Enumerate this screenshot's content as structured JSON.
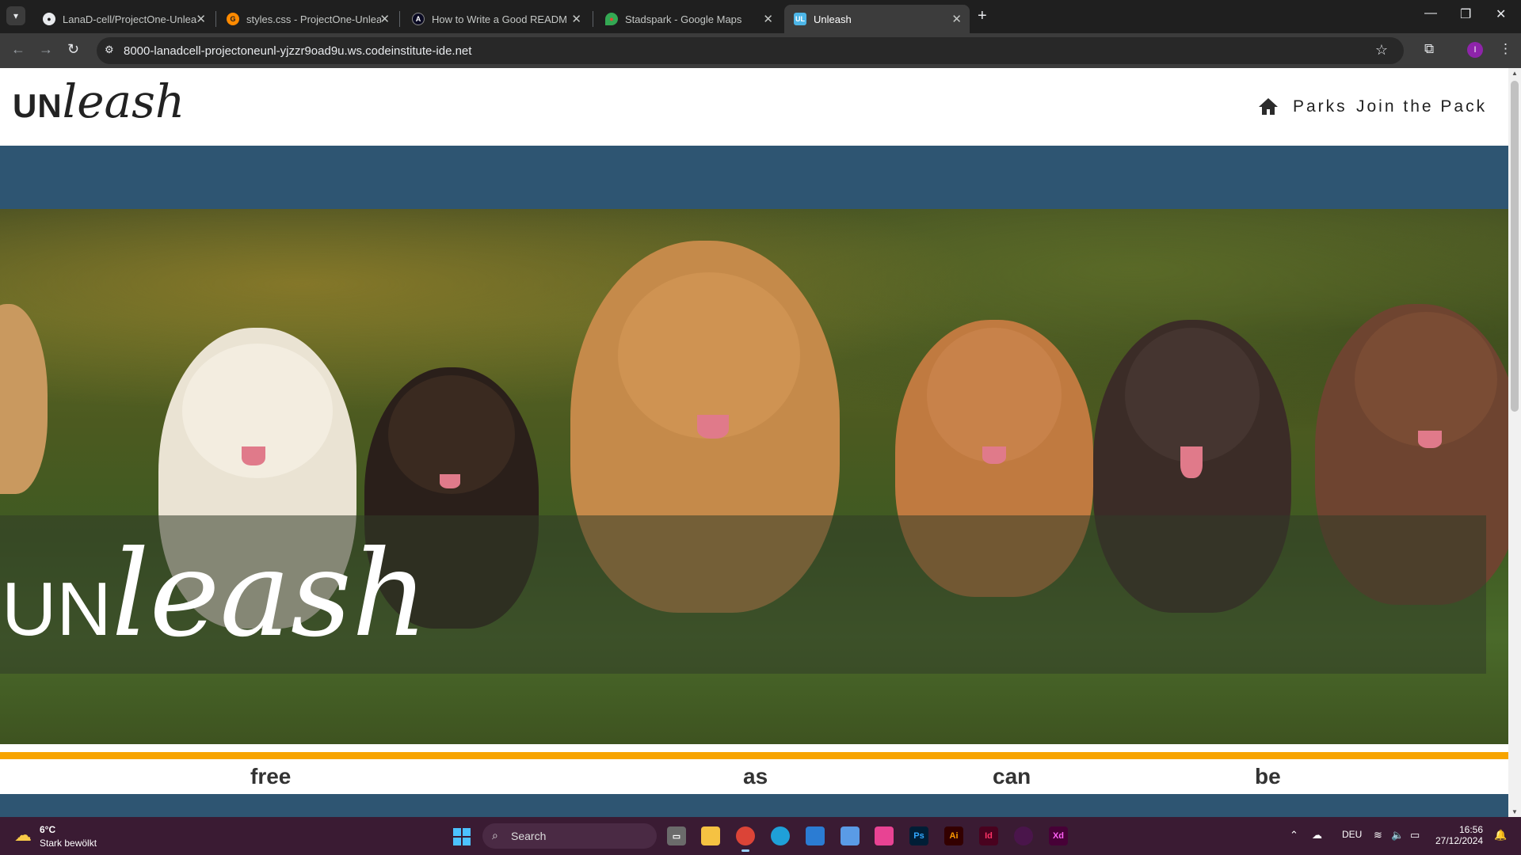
{
  "browser": {
    "tabs": [
      {
        "title": "LanaD-cell/ProjectOne-Unleash",
        "icon": "github-icon",
        "active": false
      },
      {
        "title": "styles.css - ProjectOne-Unleash",
        "icon": "gitpod-icon",
        "active": false
      },
      {
        "title": "How to Write a Good README",
        "icon": "freecodecamp-icon",
        "active": false
      },
      {
        "title": "Stadspark - Google Maps",
        "icon": "google-maps-icon",
        "active": false
      },
      {
        "title": "Unleash",
        "icon": "unleash-favicon",
        "active": true
      }
    ],
    "favicon_text": "UL",
    "url": "8000-lanadcell-projectoneunl-yjzzr9oad9u.ws.codeinstitute-ide.net",
    "profile_initial": "I"
  },
  "site": {
    "logo": {
      "un": "UN",
      "leash": "leash"
    },
    "nav": {
      "parks": "Parks",
      "join": "Join the Pack"
    },
    "hero": {
      "title_un": "UN",
      "title_leash": "leash"
    },
    "tagline_words": [
      "free",
      "as",
      "can",
      "be"
    ],
    "colors": {
      "band": "#2e5572",
      "accent": "#f7a400"
    }
  },
  "taskbar": {
    "weather": {
      "temp": "6°C",
      "desc": "Stark bewölkt"
    },
    "search": {
      "label": "Search"
    },
    "apps": [
      "task-view",
      "file-explorer",
      "chrome",
      "edge",
      "store",
      "calendar",
      "creative-cloud",
      "photoshop",
      "illustrator",
      "indesign",
      "slack",
      "xd"
    ],
    "app_labels": {
      "ps": "Ps",
      "ai": "Ai",
      "id": "Id",
      "xd": "Xd"
    },
    "language": "DEU",
    "time": "16:56",
    "date": "27/12/2024"
  }
}
